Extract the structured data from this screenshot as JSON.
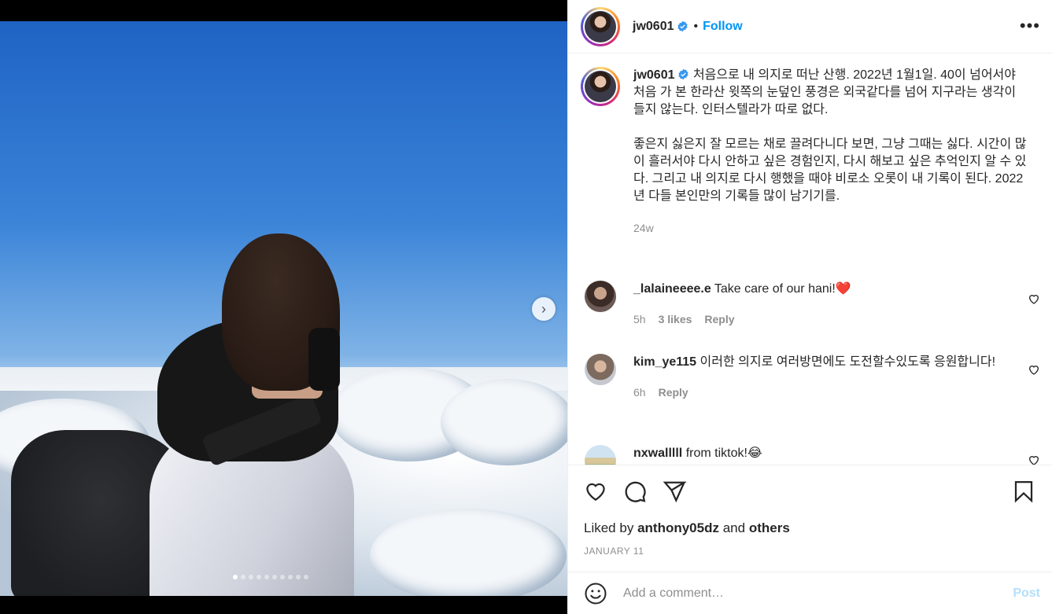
{
  "post": {
    "author": "jw0601",
    "follow_label": "Follow",
    "bullet": "•",
    "more_label": "•••"
  },
  "media": {
    "next_arrow": "›",
    "slide_count": 10,
    "active_slide": 1
  },
  "caption": {
    "username": "jw0601",
    "paragraphs": [
      "처음으로 내 의지로 떠난 산행. 2022년 1월1일. 40이 넘어서야 처음 가 본 한라산 윗쪽의 눈덮인 풍경은 외국같다를 넘어 지구라는 생각이 들지 않는다. 인터스텔라가 따로 없다.",
      "좋은지 싫은지 잘 모르는 채로 끌려다니다 보면, 그냥 그때는 싫다. 시간이 많이 흘러서야 다시 안하고 싶은 경험인지, 다시 해보고 싶은 추억인지 알 수 있다. 그리고 내 의지로 다시 행했을 때야 비로소 오롯이 내 기록이 된다. 2022년 다들 본인만의 기록들 많이 남기기를."
    ],
    "time": "24w"
  },
  "comments": [
    {
      "username": "_lalaineeee.e",
      "text": "Take care of our hani!❤️",
      "time": "5h",
      "likes": "3 likes",
      "reply": "Reply"
    },
    {
      "username": "kim_ye115",
      "text": "이러한 의지로 여러방면에도 도전할수있도록 응원합니다!",
      "time": "6h",
      "reply": "Reply"
    },
    {
      "username": "nxwalllll",
      "text": "from tiktok!😂"
    }
  ],
  "footer": {
    "liked_by_prefix": "Liked by",
    "liked_by_user": "anthony05dz",
    "liked_by_and": "and",
    "liked_by_others": "others",
    "date": "JANUARY 11",
    "comment_placeholder": "Add a comment…",
    "post_label": "Post"
  },
  "colors": {
    "accent": "#0095f6",
    "verified": "#3897f0",
    "muted": "#8e8e8e",
    "post_disabled": "#b2dffc",
    "heart_red": "#ed4956"
  }
}
